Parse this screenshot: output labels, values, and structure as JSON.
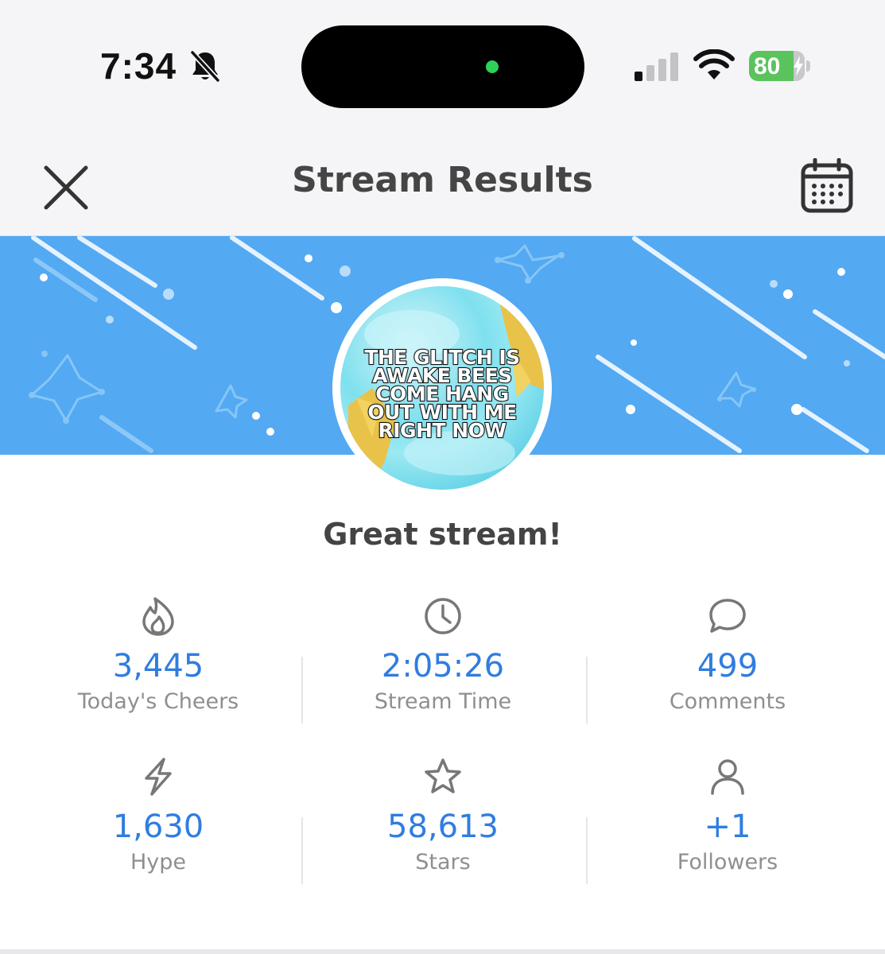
{
  "status_bar": {
    "time": "7:34",
    "battery_percent": "80",
    "battery_level": 0.8
  },
  "header": {
    "title": "Stream Results",
    "close_icon": "close-icon",
    "calendar_icon": "calendar-icon"
  },
  "banner": {
    "color": "#53a9f2",
    "avatar_text": [
      "THE GLITCH IS",
      "AWAKE BEES",
      "COME HANG",
      "OUT WITH ME",
      "RIGHT NOW"
    ]
  },
  "headline": "Great stream!",
  "stats": [
    {
      "icon": "flame-icon",
      "value": "3,445",
      "label": "Today's Cheers"
    },
    {
      "icon": "clock-icon",
      "value": "2:05:26",
      "label": "Stream Time"
    },
    {
      "icon": "comment-icon",
      "value": "499",
      "label": "Comments"
    },
    {
      "icon": "lightning-icon",
      "value": "1,630",
      "label": "Hype"
    },
    {
      "icon": "star-icon",
      "value": "58,613",
      "label": "Stars"
    },
    {
      "icon": "person-icon",
      "value": "+1",
      "label": "Followers"
    }
  ],
  "colors": {
    "value_blue": "#2f7de0",
    "label_gray": "#8f8f8f",
    "title_gray": "#454545"
  }
}
